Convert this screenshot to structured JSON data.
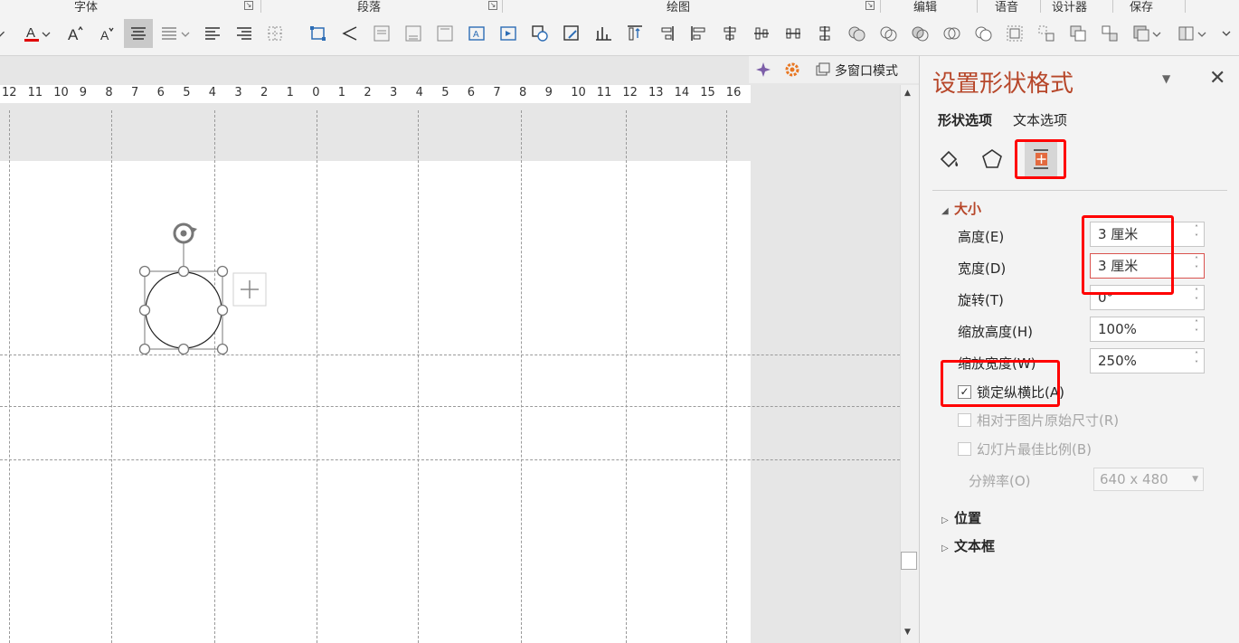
{
  "ribbon": {
    "groups": [
      {
        "name": "字体"
      },
      {
        "name": "段落"
      },
      {
        "name": "绘图"
      },
      {
        "name": "编辑"
      },
      {
        "name": "语音"
      },
      {
        "name": "设计器"
      },
      {
        "name": "保存"
      }
    ]
  },
  "mini_toolbar": {
    "multiwindow_label": "多窗口模式"
  },
  "ruler": {
    "labels": [
      "12",
      "11",
      "10",
      "9",
      "8",
      "7",
      "6",
      "5",
      "4",
      "3",
      "2",
      "1",
      "0",
      "1",
      "2",
      "3",
      "4",
      "5",
      "6",
      "7",
      "8",
      "9",
      "10",
      "11",
      "12",
      "13",
      "14",
      "15",
      "16"
    ]
  },
  "panel": {
    "title": "设置形状格式",
    "tabs": [
      "形状选项",
      "文本选项"
    ],
    "categories": [
      "fill-line-icon",
      "effects-pentagon-icon",
      "size-properties-icon"
    ],
    "size_section": {
      "title": "大小",
      "height_label": "高度(E)",
      "height_value": "3 厘米",
      "width_label": "宽度(D)",
      "width_value": "3 厘米",
      "rotation_label": "旋转(T)",
      "rotation_value": "0°",
      "scale_height_label": "缩放高度(H)",
      "scale_height_value": "100%",
      "scale_width_label": "缩放宽度(W)",
      "scale_width_value": "250%",
      "lock_aspect_label": "锁定纵横比(A)",
      "lock_aspect_checked": true,
      "relative_original_label": "相对于图片原始尺寸(R)",
      "best_scale_label": "幻灯片最佳比例(B)",
      "resolution_label": "分辨率(O)",
      "resolution_value": "640 x 480"
    },
    "position_section": "位置",
    "textbox_section": "文本框"
  },
  "colors": {
    "accent": "#b7472a",
    "highlight": "#ff0000"
  }
}
